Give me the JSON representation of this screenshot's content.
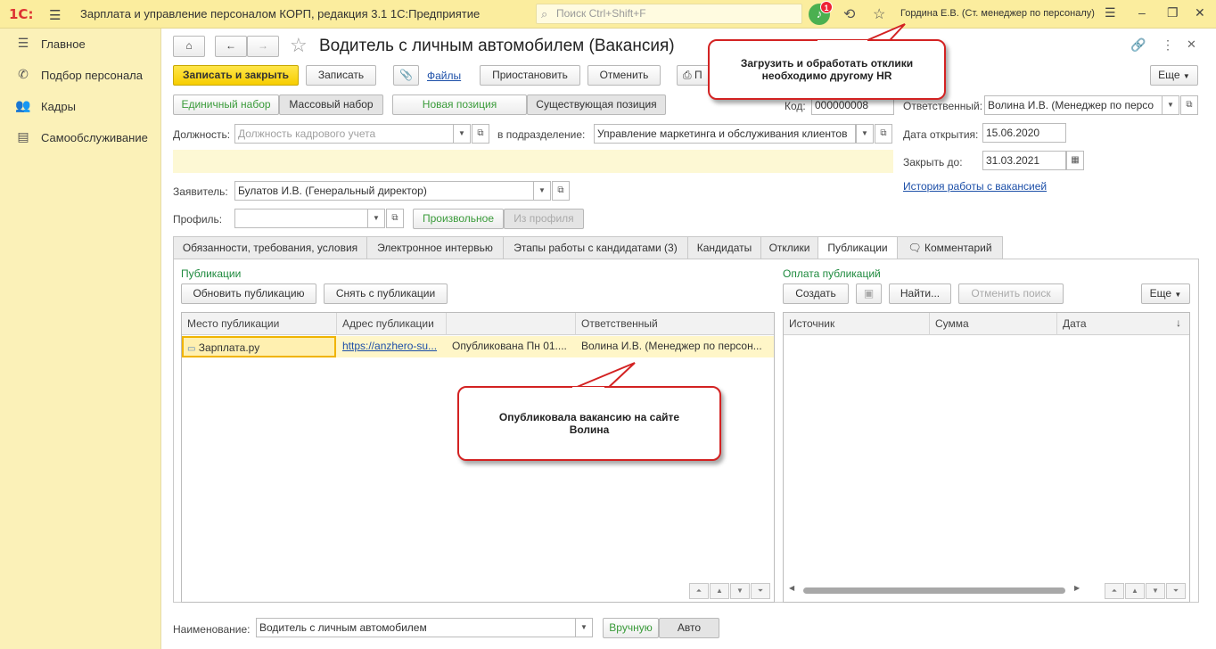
{
  "topbar": {
    "logo": "1С:",
    "app_title": "Зарплата и управление персоналом КОРП, редакция 3.1 1С:Предприятие",
    "search_placeholder": "Поиск Ctrl+Shift+F",
    "notifications_count": "1",
    "user": "Гордина Е.В. (Ст. менеджер по персоналу)",
    "icons": [
      "burger-menu-icon",
      "search-icon",
      "bell-icon",
      "history-icon",
      "star-icon",
      "settings-lines-icon",
      "minimize-icon",
      "restore-icon",
      "close-icon"
    ]
  },
  "sidebar": {
    "items": [
      {
        "label": "Главное",
        "icon": "menu-icon"
      },
      {
        "label": "Подбор персонала",
        "icon": "phone-icon"
      },
      {
        "label": "Кадры",
        "icon": "people-icon"
      },
      {
        "label": "Самообслуживание",
        "icon": "list-icon"
      }
    ]
  },
  "form": {
    "title": "Водитель с личным автомобилем (Вакансия)",
    "toolbar": {
      "save_close": "Записать и закрыть",
      "save": "Записать",
      "files": "Файлы",
      "suspend": "Приостановить",
      "cancel": "Отменить",
      "print": "П",
      "more": "Еще"
    },
    "toggles": {
      "single": "Единичный набор",
      "mass": "Массовый набор",
      "new_position": "Новая позиция",
      "existing_position": "Существующая позиция"
    },
    "code_label": "Код:",
    "code_value": "000000008",
    "responsible_label": "Ответственный:",
    "responsible_value": "Волина И.В. (Менеджер по персо",
    "position_label": "Должность:",
    "position_placeholder": "Должность кадрового учета",
    "department_label": "в подразделение:",
    "department_value": "Управление маркетинга и обслуживания клиентов",
    "open_date_label": "Дата открытия:",
    "open_date_value": "15.06.2020",
    "close_date_label": "Закрыть до:",
    "close_date_value": "31.03.2021",
    "history_link": "История работы с вакансией",
    "applicant_label": "Заявитель:",
    "applicant_value": "Булатов И.В. (Генеральный директор)",
    "profile_label": "Профиль:",
    "profile_value": "",
    "profile_arbitrary": "Произвольное",
    "profile_from": "Из профиля",
    "name_label": "Наименование:",
    "name_value": "Водитель с личным автомобилем",
    "name_manual": "Вручную",
    "name_auto": "Авто"
  },
  "tabs": [
    "Обязанности, требования, условия",
    "Электронное интервью",
    "Этапы работы с кандидатами (3)",
    "Кандидаты",
    "Отклики",
    "Публикации",
    "Комментарий"
  ],
  "publications": {
    "title": "Публикации",
    "update_btn": "Обновить публикацию",
    "remove_btn": "Снять с публикации",
    "columns": [
      "Место публикации",
      "Адрес публикации",
      "",
      "Ответственный"
    ],
    "rows": [
      {
        "place": "Зарплата.ру",
        "address": "https://anzhero-su...",
        "status": "Опубликована Пн 01....",
        "responsible": "Волина И.В. (Менеджер по персон..."
      }
    ]
  },
  "payments": {
    "title": "Оплата публикаций",
    "create_btn": "Создать",
    "find_btn": "Найти...",
    "cancel_search_btn": "Отменить поиск",
    "more_btn": "Еще",
    "columns": [
      "Источник",
      "Сумма",
      "Дата"
    ]
  },
  "callouts": {
    "top": "Загрузить и обработать отклики необходимо другому HR",
    "middle": "Опубликовала вакансию на сайте Волина"
  }
}
